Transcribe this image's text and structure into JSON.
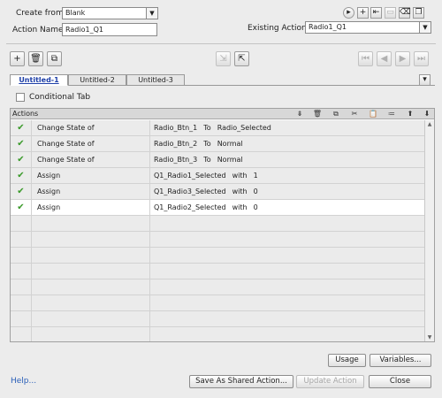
{
  "header": {
    "create_from_label": "Create from:",
    "create_from_value": "Blank",
    "action_name_label": "Action Name:",
    "action_name_value": "Radio1_Q1",
    "existing_actions_label": "Existing Actions:",
    "existing_actions_value": "Radio1_Q1"
  },
  "tabs": [
    {
      "label": "Untitled-1",
      "active": true
    },
    {
      "label": "Untitled-2",
      "active": false
    },
    {
      "label": "Untitled-3",
      "active": false
    }
  ],
  "conditional_tab_label": "Conditional Tab",
  "grid": {
    "header_label": "Actions",
    "rows": [
      {
        "status": "✔",
        "action": "Change State of",
        "target": "Radio_Btn_1",
        "keyword": "To",
        "value": "Radio_Selected"
      },
      {
        "status": "✔",
        "action": "Change State of",
        "target": "Radio_Btn_2",
        "keyword": "To",
        "value": "Normal"
      },
      {
        "status": "✔",
        "action": "Change State of",
        "target": "Radio_Btn_3",
        "keyword": "To",
        "value": "Normal"
      },
      {
        "status": "✔",
        "action": "Assign",
        "target": "Q1_Radio1_Selected",
        "keyword": "with",
        "value": "1"
      },
      {
        "status": "✔",
        "action": "Assign",
        "target": "Q1_Radio3_Selected",
        "keyword": "with",
        "value": "0"
      },
      {
        "status": "✔",
        "action": "Assign",
        "target": "Q1_Radio2_Selected",
        "keyword": "with",
        "value": "0"
      }
    ],
    "selected_row": 5
  },
  "buttons": {
    "usage": "Usage",
    "variables": "Variables...",
    "help": "Help...",
    "save_shared": "Save As Shared Action...",
    "update_action": "Update Action",
    "close": "Close"
  },
  "colors": {
    "background": "#ececec",
    "active_tab_text": "#1e3fa8",
    "check": "#3a9a2a",
    "help_link": "#2a5fb8"
  }
}
